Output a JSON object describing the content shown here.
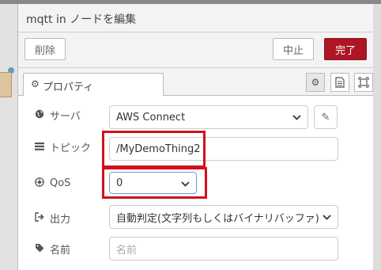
{
  "dialog": {
    "title": "mqtt in ノードを編集",
    "delete_label": "削除",
    "cancel_label": "中止",
    "done_label": "完了"
  },
  "tabs": [
    {
      "label": "プロパティ",
      "icon": "gear-icon"
    }
  ],
  "tab_icons": [
    "settings-gear-icon",
    "document-icon",
    "layout-frame-icon"
  ],
  "form": {
    "server": {
      "label": "サーバ",
      "icon": "globe-icon",
      "value": "AWS Connect"
    },
    "topic": {
      "label": "トピック",
      "icon": "tasks-icon",
      "value": "/MyDemoThing2"
    },
    "qos": {
      "label": "QoS",
      "icon": "empire-icon",
      "value": "0"
    },
    "output": {
      "label": "出力",
      "icon": "sign-out-icon",
      "value": "自動判定(文字列もしくはバイナリバッファ)"
    },
    "name": {
      "label": "名前",
      "icon": "tag-icon",
      "value": "",
      "placeholder": "名前"
    }
  },
  "colors": {
    "primary": "#ad1625",
    "highlight": "#d1111c"
  }
}
